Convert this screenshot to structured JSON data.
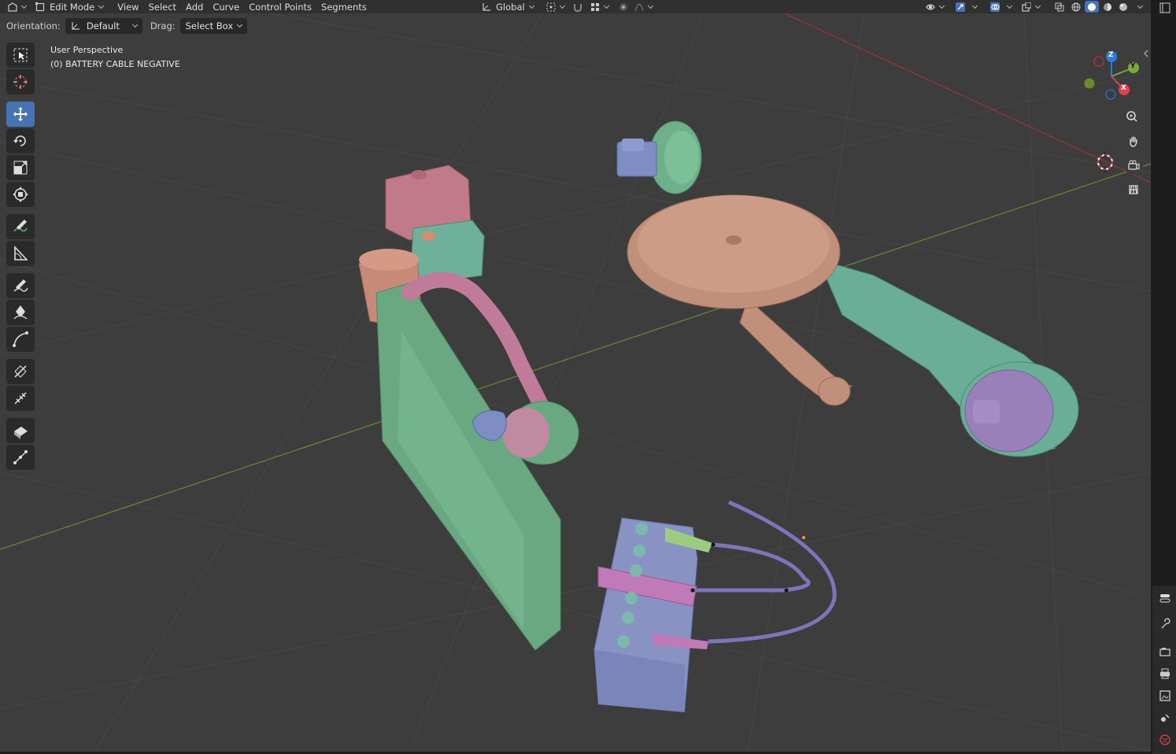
{
  "header": {
    "mode": "Edit Mode",
    "menus": [
      "View",
      "Select",
      "Add",
      "Curve",
      "Control Points",
      "Segments"
    ],
    "transform_orientation": "Global"
  },
  "tool_settings": {
    "orientation_label": "Orientation:",
    "orientation_value": "Default",
    "drag_label": "Drag:",
    "drag_value": "Select Box"
  },
  "viewport_info": {
    "line1": "User Perspective",
    "line2": "(0) BATTERY CABLE NEGATIVE"
  },
  "gizmo": {
    "x": "X",
    "y": "Y",
    "z": "Z"
  },
  "colors": {
    "accent": "#4772b3",
    "axis_x": "#e0414f",
    "axis_y": "#7aa83a",
    "axis_z": "#2d7be0"
  },
  "toolbar_icons": [
    "select-box-icon",
    "cursor-icon",
    "move-icon",
    "rotate-icon",
    "scale-icon",
    "transform-icon",
    "annotate-icon",
    "measure-icon",
    "draw-icon",
    "pen-icon",
    "curve-icon",
    "tilt-icon",
    "radius-icon",
    "extrude-icon",
    "randomize-icon"
  ]
}
